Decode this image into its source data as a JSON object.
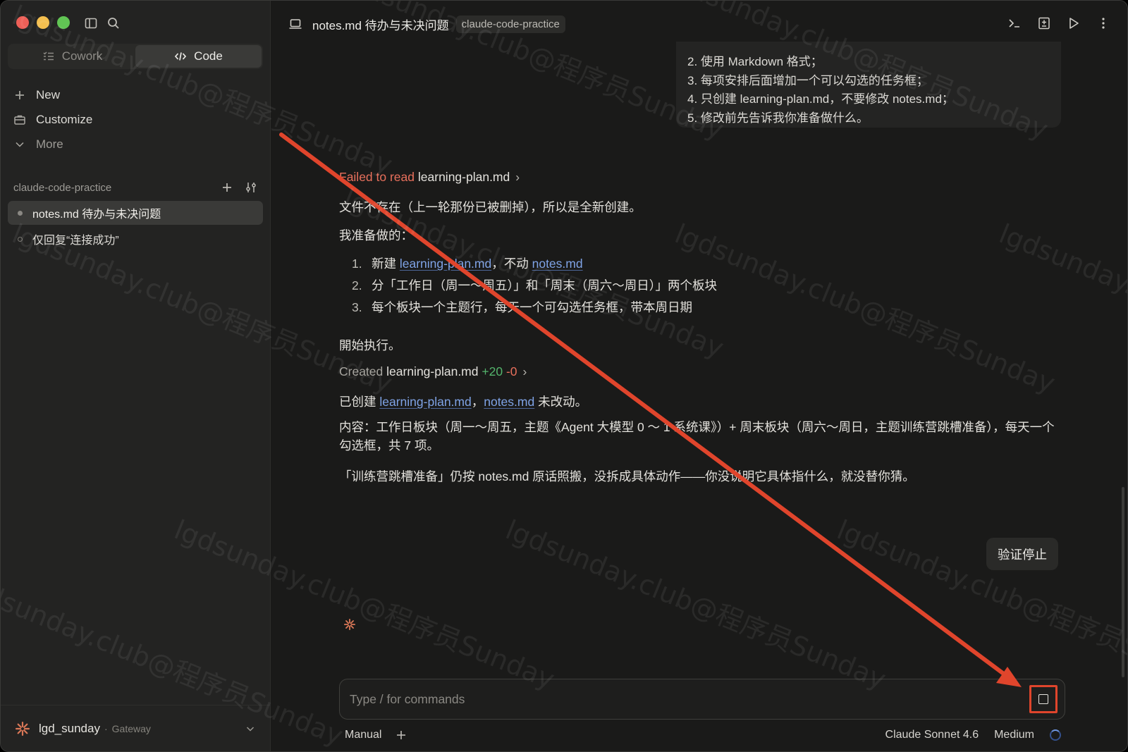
{
  "sidebar": {
    "modes": [
      {
        "label": "Cowork",
        "active": false
      },
      {
        "label": "Code",
        "active": true
      }
    ],
    "nav": {
      "new": "New",
      "customize": "Customize",
      "more": "More"
    },
    "project": {
      "name": "claude-code-practice"
    },
    "sessions": [
      {
        "title": "notes.md 待办与未决问题",
        "active": true
      },
      {
        "title": "仅回复“连接成功”",
        "active": false
      }
    ],
    "account": {
      "name": "lgd_sunday",
      "separator": "·",
      "plan": "Gateway"
    }
  },
  "header": {
    "title": "notes.md 待办与未决问题",
    "project_tag": "claude-code-practice"
  },
  "user_message": {
    "lines": [
      "2. 使用 Markdown 格式；",
      "3. 每项安排后面增加一个可以勾选的任务框；",
      "4. 只创建 learning-plan.md，不要修改 notes.md；",
      "5. 修改前先告诉我你准备做什么。"
    ]
  },
  "assistant": {
    "tool_read": {
      "status": "Failed to read",
      "file": "learning-plan.md"
    },
    "file_missing": "文件不存在（上一轮那份已被删掉），所以是全新创建。",
    "plan_intro": "我准备做的：",
    "plan_items": [
      {
        "num": "1.",
        "pre": "新建 ",
        "link1": "learning-plan.md",
        "mid": "，不动 ",
        "link2": "notes.md"
      },
      {
        "num": "2.",
        "text": "分「工作日（周一～周五）」和「周末（周六～周日）」两个板块"
      },
      {
        "num": "3.",
        "text": "每个板块一个主题行，每天一个可勾选任务框，带本周日期"
      }
    ],
    "start": "開始执行。",
    "tool_create": {
      "status": "Created",
      "file": "learning-plan.md",
      "added": "+20",
      "removed": "-0"
    },
    "done": {
      "pre": "已创建 ",
      "link1": "learning-plan.md",
      "mid": "，",
      "link2": "notes.md",
      "post": " 未改动。"
    },
    "content_summary": "内容：工作日板块（周一～周五，主题《Agent 大模型 0 ～ 1 系统课》）+ 周末板块（周六～周日，主题训练营跳槽准备），每天一个勾选框，共 7 项。",
    "note": "「训练营跳槽准备」仍按 notes.md 原话照搬，没拆成具体动作——你没说明它具体指什么，就没替你猜。"
  },
  "queued_message": "验证停止",
  "composer": {
    "placeholder": "Type / for commands"
  },
  "footer": {
    "mode": "Manual",
    "model": "Claude Sonnet 4.6",
    "effort": "Medium"
  },
  "watermark": "lgdsunday.club@程序员Sunday",
  "colors": {
    "accent": "#d97757",
    "link": "#7fa3e6",
    "annotation": "#e0452c",
    "added": "#54b46c",
    "error": "#e8705c"
  }
}
